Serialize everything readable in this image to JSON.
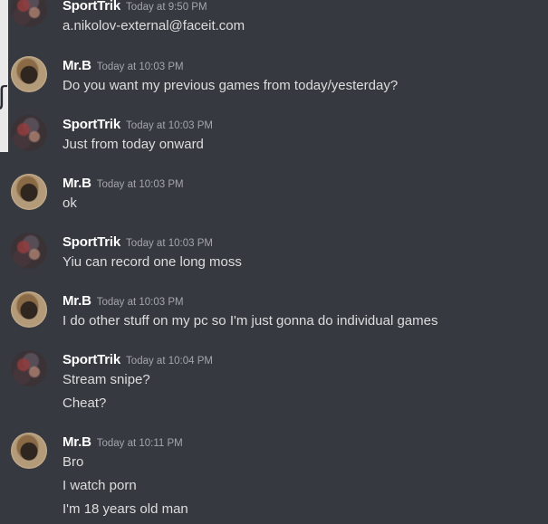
{
  "messages": [
    {
      "author": "SportTrik",
      "timestamp": "Today at 9:50 PM",
      "avatar": "sporttrik-avatar",
      "lines": [
        "a.nikolov-external@faceit.com"
      ]
    },
    {
      "author": "Mr.B",
      "timestamp": "Today at 10:03 PM",
      "avatar": "mrb-cat-avatar",
      "lines": [
        "Do you want my previous games from today/yesterday?"
      ]
    },
    {
      "author": "SportTrik",
      "timestamp": "Today at 10:03 PM",
      "avatar": "sporttrik-avatar",
      "lines": [
        "Just from today onward"
      ]
    },
    {
      "author": "Mr.B",
      "timestamp": "Today at 10:03 PM",
      "avatar": "mrb-cat-avatar",
      "lines": [
        "ok"
      ]
    },
    {
      "author": "SportTrik",
      "timestamp": "Today at 10:03 PM",
      "avatar": "sporttrik-avatar",
      "lines": [
        "Yiu can record one long moss"
      ]
    },
    {
      "author": "Mr.B",
      "timestamp": "Today at 10:03 PM",
      "avatar": "mrb-cat-avatar",
      "lines": [
        "I do other stuff on my pc so I'm just gonna do individual games"
      ]
    },
    {
      "author": "SportTrik",
      "timestamp": "Today at 10:04 PM",
      "avatar": "sporttrik-avatar",
      "lines": [
        "Stream snipe?",
        "Cheat?"
      ]
    },
    {
      "author": "Mr.B",
      "timestamp": "Today at 10:11 PM",
      "avatar": "mrb-cat-avatar",
      "lines": [
        "Bro",
        "I watch porn",
        "I'm 18 years old man"
      ]
    }
  ],
  "colors": {
    "background": "#36393f",
    "username": "#ffffff",
    "timestamp": "#a3a6aa",
    "message_text": "#dcddde"
  }
}
